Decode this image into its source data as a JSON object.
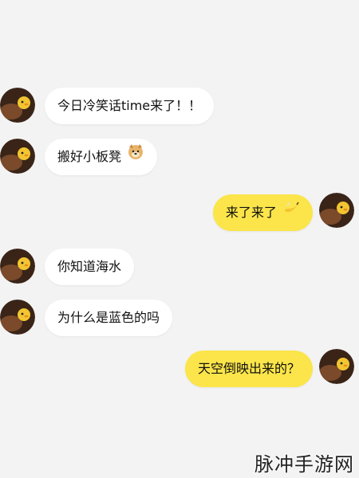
{
  "chat": {
    "messages": [
      {
        "side": "left",
        "text": "今日冷笑话time来了！！",
        "emoji": ""
      },
      {
        "side": "left",
        "text": "搬好小板凳",
        "emoji": "doge-emoji"
      },
      {
        "side": "right",
        "text": "来了来了",
        "emoji": "banana-emoji"
      },
      {
        "side": "left",
        "text": "你知道海水",
        "emoji": ""
      },
      {
        "side": "left",
        "text": "为什么是蓝色的吗",
        "emoji": ""
      },
      {
        "side": "right",
        "text": "天空倒映出来的？",
        "emoji": ""
      }
    ]
  },
  "watermark": {
    "text": "脉冲手游网"
  },
  "colors": {
    "background": "#f3f3f3",
    "left_bubble": "#ffffff",
    "right_bubble": "#fbe54a",
    "avatar_bg": "#3a2418",
    "avatar_accent": "#f2c531"
  }
}
